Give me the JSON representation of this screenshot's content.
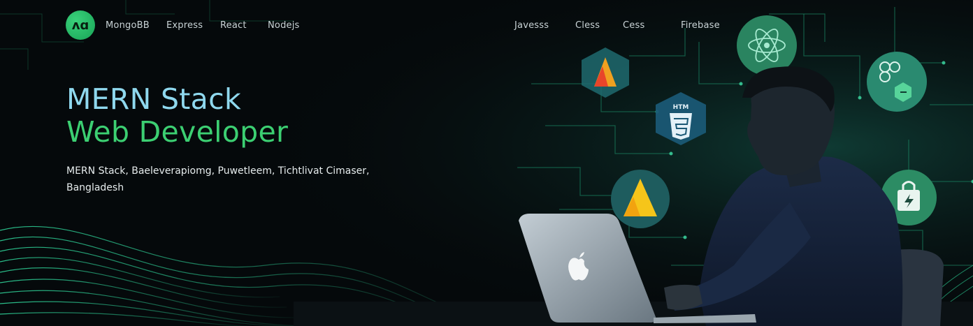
{
  "logo": {
    "text": "ᴧɑ",
    "icon": "mern-logo-icon"
  },
  "nav_left": [
    "MongoBB",
    "Express",
    "React",
    "Nodejs"
  ],
  "nav_right": [
    "Javesss",
    "Cless",
    "Cess",
    "Firebase"
  ],
  "hero": {
    "title_line1": "MERN Stack",
    "title_line2": "Web Developer",
    "subtitle_line1": "MERN Stack, Baeleverapiomg, Puwetleem, Tichtlivat Cimaser,",
    "subtitle_line2": "Bangladesh"
  },
  "badges": {
    "html": "HTM"
  },
  "colors": {
    "accent_green": "#3ccf72",
    "accent_cyan": "#8fd8ee",
    "background": "#05090b"
  },
  "icons": [
    "firebase-icon",
    "html5-icon",
    "react-icon",
    "graphql-node-icon",
    "shopify-bag-icon",
    "apple-logo-icon"
  ]
}
